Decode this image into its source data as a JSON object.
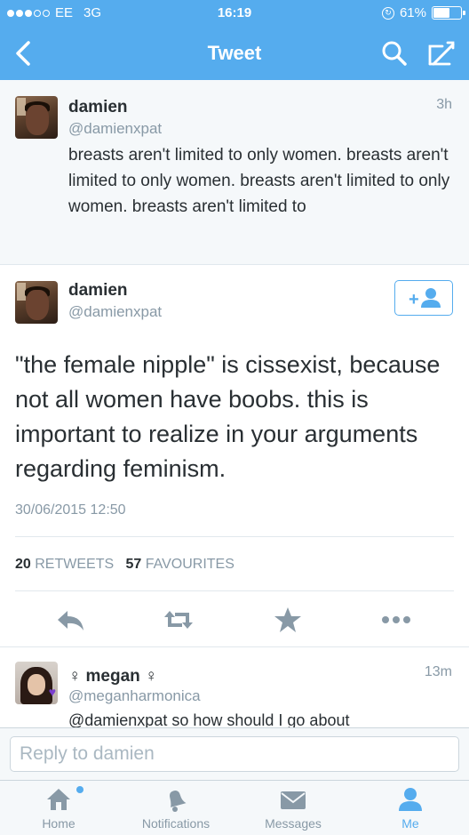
{
  "status_bar": {
    "carrier": "EE",
    "network": "3G",
    "time": "16:19",
    "battery": "61%",
    "battery_level": 0.61
  },
  "nav": {
    "title": "Tweet"
  },
  "parent_tweet": {
    "name": "damien",
    "handle": "@damienxpat",
    "time_ago": "3h",
    "text": "breasts aren't limited to only women. breasts aren't limited to only women. breasts aren't limited to only women. breasts aren't limited to"
  },
  "main_tweet": {
    "name": "damien",
    "handle": "@damienxpat",
    "text": "\"the female nipple\" is cissexist, because not all women have boobs. this is important to realize in your arguments regarding feminism.",
    "date": "30/06/2015 12:50",
    "retweets_count": "20",
    "retweets_label": "RETWEETS",
    "favourites_count": "57",
    "favourites_label": "FAVOURITES"
  },
  "reply_tweet": {
    "name": "♀ megan ♀",
    "handle": "@meganharmonica",
    "time_ago": "13m",
    "text": "@damienxpat so how should I go about"
  },
  "reply_box": {
    "placeholder": "Reply to damien"
  },
  "tabs": [
    {
      "label": "Home",
      "icon": "home-icon"
    },
    {
      "label": "Notifications",
      "icon": "bell-icon"
    },
    {
      "label": "Messages",
      "icon": "envelope-icon"
    },
    {
      "label": "Me",
      "icon": "person-icon"
    }
  ],
  "colors": {
    "brand": "#55acee",
    "text": "#292f33",
    "muted": "#8899a6",
    "border": "#e1e8ed"
  }
}
